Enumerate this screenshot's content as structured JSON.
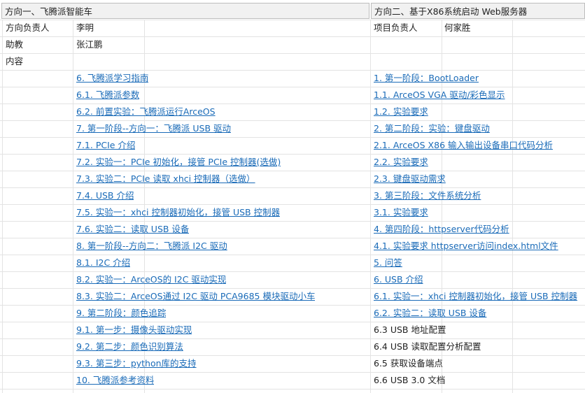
{
  "header": {
    "left_title": "方向一、飞腾派智能车",
    "right_title": "方向二、基于X86系统启动 Web服务器"
  },
  "info": {
    "left_owner_label": "方向负责人",
    "left_owner_value": "李明",
    "assistant_label": "助教",
    "assistant_value": "张江鹏",
    "content_label": "内容",
    "right_owner_label": "项目负责人",
    "right_owner_value": "何家胜"
  },
  "left_links": [
    "6. 飞腾派学习指南",
    "6.1. 飞腾派参数",
    "6.2. 前置实验：飞腾派运行ArceOS",
    "7. 第一阶段--方向一：飞腾派 USB 驱动",
    "7.1. PCIe 介绍",
    "7.2. 实验一：PCIe 初始化，接管 PCIe 控制器(选做)",
    "7.3. 实验二：PCIe 读取 xhci 控制器（选做）",
    "7.4. USB 介绍",
    "7.5. 实验一：xhci 控制器初始化，接管 USB 控制器",
    "7.6. 实验二：读取 USB 设备",
    "8. 第一阶段--方向二：飞腾派 I2C 驱动",
    "8.1. I2C 介绍",
    "8.2. 实验一：ArceOS的 I2C 驱动实现",
    "8.3. 实验二：ArceOS通过 I2C 驱动 PCA9685 模块驱动小车",
    "9. 第二阶段：颜色追踪",
    "9.1. 第一步：摄像头驱动实现",
    "9.2. 第二步：颜色识别算法",
    "9.3. 第三步：python库的支持",
    "10. 飞腾派参考资料"
  ],
  "right_items": [
    {
      "text": "1. 第一阶段：BootLoader",
      "link": true
    },
    {
      "text": "1.1. ArceOS VGA 驱动/彩色显示",
      "link": true
    },
    {
      "text": "1.2. 实验要求",
      "link": true
    },
    {
      "text": "2. 第二阶段：实验：键盘驱动",
      "link": true
    },
    {
      "text": "2.1. ArceOS X86 输入输出设备串口代码分析",
      "link": true
    },
    {
      "text": "2.2. 实验要求",
      "link": true
    },
    {
      "text": "2.3. 键盘驱动需求",
      "link": true
    },
    {
      "text": "3. 第三阶段：文件系统分析",
      "link": true
    },
    {
      "text": "3.1. 实验要求",
      "link": true
    },
    {
      "text": "4. 第四阶段：httpserver代码分析",
      "link": true
    },
    {
      "text": "4.1. 实验要求 httpserver访问index.html文件",
      "link": true
    },
    {
      "text": "5. 问答",
      "link": true
    },
    {
      "text": "6. USB 介绍",
      "link": true
    },
    {
      "text": "6.1. 实验一：xhci 控制器初始化，接管 USB 控制器",
      "link": true
    },
    {
      "text": "6.2. 实验二：读取 USB 设备",
      "link": true
    },
    {
      "text": "6.3 USB 地址配置",
      "link": false
    },
    {
      "text": "6.4 USB 读取配置分析配置",
      "link": false
    },
    {
      "text": "6.5 获取设备端点",
      "link": false
    },
    {
      "text": "6.6 USB 3.0 文档",
      "link": false
    }
  ],
  "colors": {
    "link": "#1a6bb8",
    "grid": "#e3e3e3",
    "header_bg": "#f1f1f1",
    "header_border": "#bdbdbd"
  }
}
